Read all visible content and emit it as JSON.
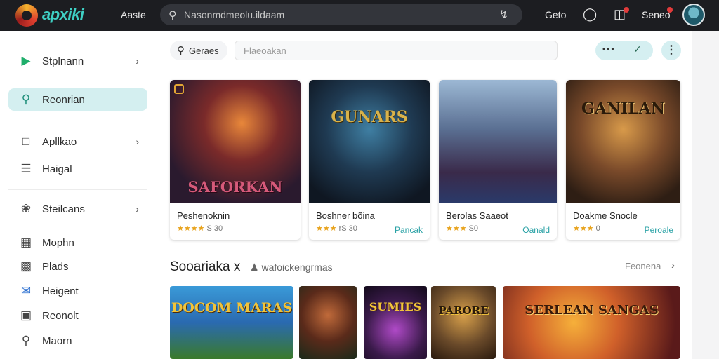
{
  "topbar": {
    "brand": "apxiki",
    "link": "Aaste",
    "search_text": "Nasonmdmeolu.ildaam",
    "settings_label": "Geto",
    "user_name": "Seneo",
    "icons": {
      "search": "search-icon",
      "mic": "mic-icon",
      "bell": "bell-icon",
      "cart": "cart-icon"
    }
  },
  "sidebar": {
    "items": [
      {
        "label": "Stplnann",
        "icon": "play-icon",
        "chevron": true
      },
      {
        "label": "Reonrian",
        "icon": "search-icon",
        "active": true
      },
      {
        "label": "Apllkao",
        "icon": "window-icon",
        "chevron": true
      },
      {
        "label": "Haigal",
        "icon": "list-icon"
      },
      {
        "label": "Steilcans",
        "icon": "leaf-icon",
        "chevron": true
      },
      {
        "label": "Mophn",
        "icon": "calendar-icon"
      },
      {
        "label": "Plads",
        "icon": "image-icon"
      },
      {
        "label": "Heigent",
        "icon": "mail-icon"
      },
      {
        "label": "Reonolt",
        "icon": "chat-icon"
      },
      {
        "label": "Maorn",
        "icon": "search-icon"
      }
    ]
  },
  "toolbar": {
    "filter_label": "Geraes",
    "search_placeholder": "Flaeoakan",
    "more": "⋮"
  },
  "cards": [
    {
      "title": "Peshenoknin",
      "rating": "★★★★",
      "count": "S 30",
      "action": "",
      "art_text": "SAFORKAN"
    },
    {
      "title": "Boshner bõina",
      "rating": "★★★",
      "count": "rS 30",
      "action": "Pancak",
      "art_text": "GUNARS"
    },
    {
      "title": "Berolas Saaeot",
      "rating": "★★★",
      "count": "S0",
      "action": "Oanald",
      "art_text": ""
    },
    {
      "title": "Doakme Snocle",
      "rating": "★★★",
      "count": "0",
      "action": "Peroale",
      "art_text": "GANILAN"
    }
  ],
  "section": {
    "title": "Sooariaka x",
    "subtitle": "wafoickengrmas",
    "link": "Feonena",
    "thumbs": [
      {
        "art_text": "DOCOM MARAS"
      },
      {
        "art_text": ""
      },
      {
        "art_text": "SUMIES"
      },
      {
        "art_text": "PARORE"
      },
      {
        "art_text": "SERLEAN  SANGAS"
      }
    ]
  },
  "colors": {
    "accent": "#2aa2a6",
    "topbar": "#1c1d21",
    "active_item": "#d4eff0",
    "star": "#e8a21a"
  }
}
